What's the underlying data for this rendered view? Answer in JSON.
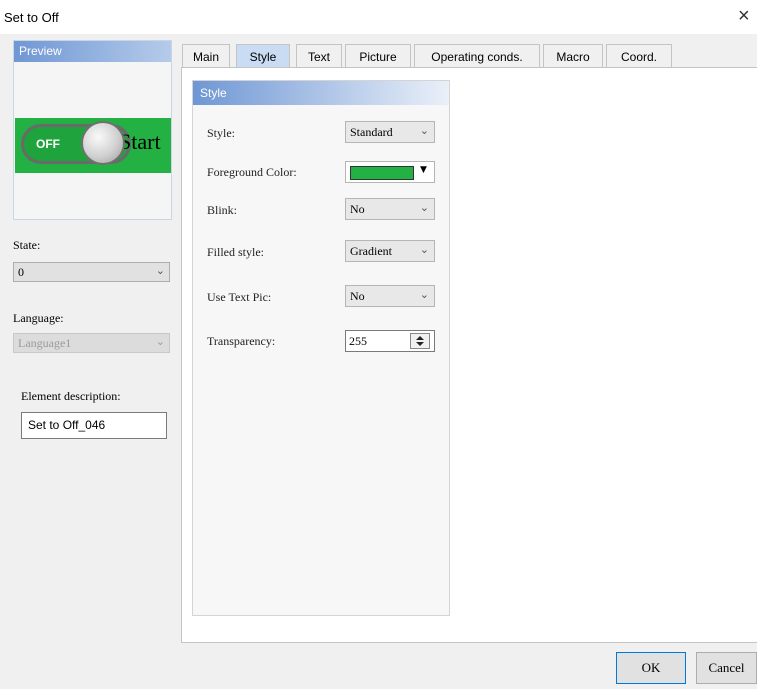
{
  "window": {
    "title": "Set to Off",
    "close_glyph": "×"
  },
  "preview": {
    "title": "Preview",
    "switch": {
      "off_label": "OFF",
      "start_label": "Start",
      "fill_color": "#22b142"
    }
  },
  "state": {
    "label": "State:",
    "value": "0"
  },
  "language": {
    "label": "Language:",
    "value": "Language1"
  },
  "element_description": {
    "label": "Element description:",
    "value": "Set to Off_046"
  },
  "tabs": [
    {
      "label": "Main"
    },
    {
      "label": "Style",
      "active": true
    },
    {
      "label": "Text"
    },
    {
      "label": "Picture"
    },
    {
      "label": "Operating conds."
    },
    {
      "label": "Macro"
    },
    {
      "label": "Coord."
    }
  ],
  "style_group": {
    "title": "Style",
    "style": {
      "label": "Style:",
      "value": "Standard"
    },
    "foreground_color": {
      "label": "Foreground Color:",
      "color": "#22b142"
    },
    "blink": {
      "label": "Blink:",
      "value": "No"
    },
    "filled_style": {
      "label": "Filled style:",
      "value": "Gradient"
    },
    "use_text_pic": {
      "label": "Use Text Pic:",
      "value": "No"
    },
    "transparency": {
      "label": "Transparency:",
      "value": "255"
    }
  },
  "buttons": {
    "ok": "OK",
    "cancel": "Cancel"
  }
}
